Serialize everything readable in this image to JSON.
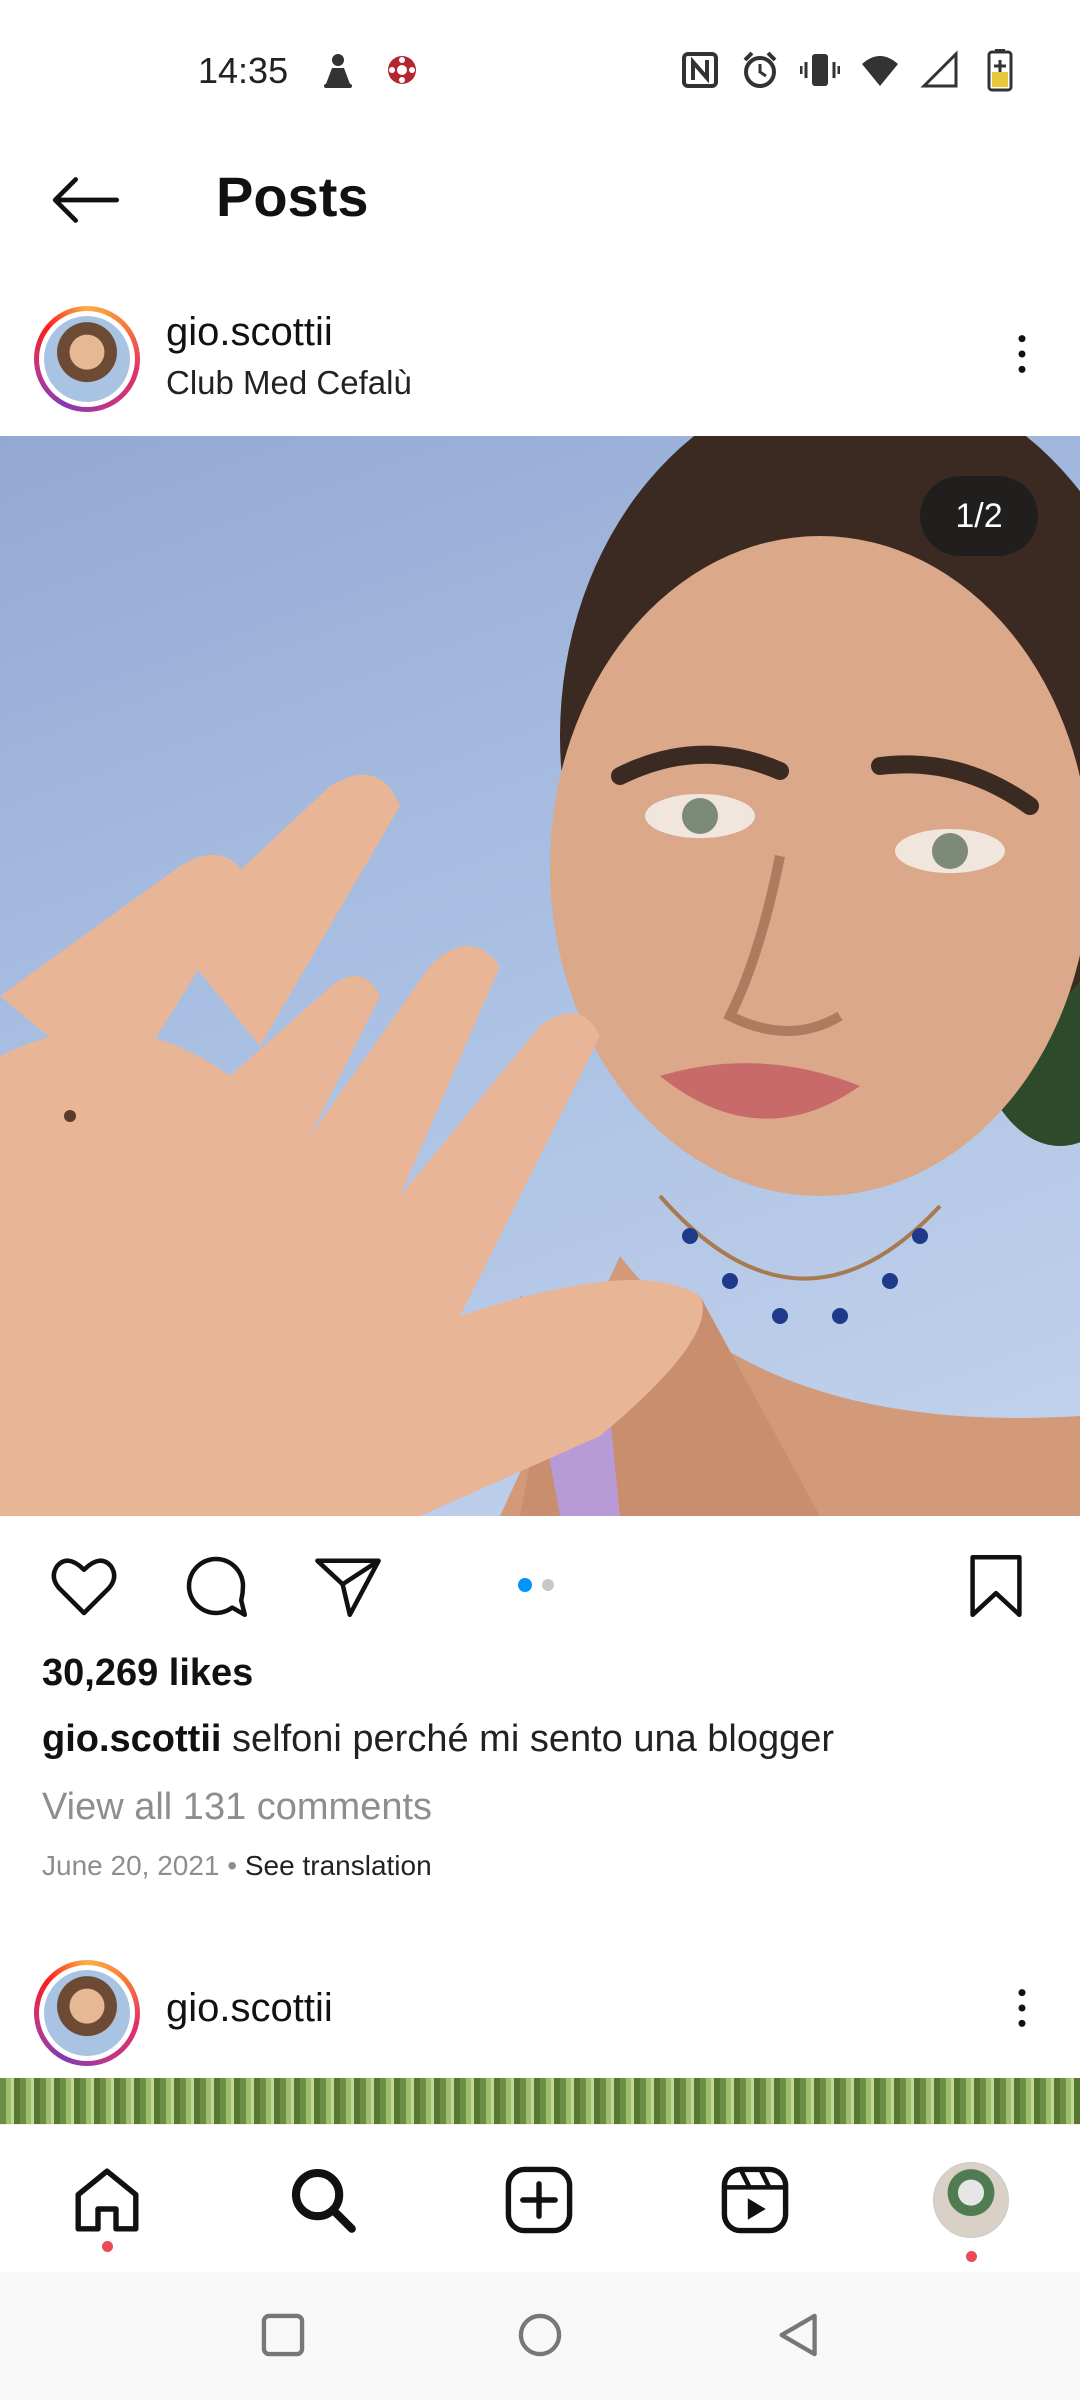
{
  "status_bar": {
    "time": "14:35",
    "left_icons": [
      "android-icon",
      "flower-notification-icon"
    ],
    "right_icons": [
      "nfc-icon",
      "alarm-icon",
      "vibrate-icon",
      "wifi-icon",
      "signal-icon",
      "battery-charging-icon"
    ]
  },
  "header": {
    "title": "Posts",
    "back_icon": "arrow-left-icon"
  },
  "post": {
    "username": "gio.scottii",
    "location": "Club Med Cefalù",
    "photo_counter": "1/2",
    "carousel": {
      "total": 2,
      "active": 1
    },
    "likes": "30,269 likes",
    "caption_user": "gio.scottii",
    "caption_text": "selfoni perché mi sento una blogger",
    "view_comments": "View all 131 comments",
    "date": "June 20, 2021",
    "separator": "•",
    "see_translation": "See translation"
  },
  "next_post": {
    "username": "gio.scottii"
  },
  "bottom_nav": {
    "items": [
      "home-icon",
      "search-icon",
      "create-post-icon",
      "reels-icon",
      "profile-avatar"
    ]
  },
  "system_nav": {
    "items": [
      "recents-square-icon",
      "home-circle-icon",
      "back-triangle-icon"
    ]
  },
  "colors": {
    "accent_blue": "#0095f6",
    "notification_red": "#ed4956",
    "text_primary": "#111111",
    "text_secondary": "#8e8e8e"
  }
}
